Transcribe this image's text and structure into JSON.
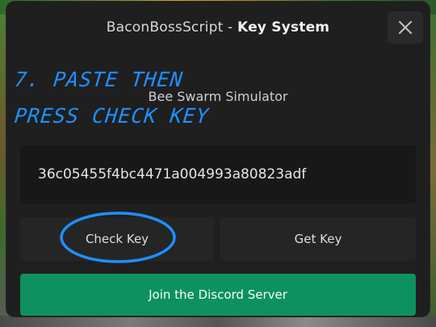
{
  "dialog": {
    "title_prefix": "BaconBossScript - ",
    "title_bold": "Key System",
    "subtitle": "Bee Swarm Simulator",
    "close_icon": "close-icon"
  },
  "key_input": {
    "value": "36c05455f4bc4471a004993a80823adf"
  },
  "buttons": {
    "check_key": "Check Key",
    "get_key": "Get Key",
    "discord": "Join the Discord Server"
  },
  "annotation": {
    "line1": "7. PASTE THEN",
    "line2": "PRESS CHECK KEY",
    "color": "#1e90ff"
  },
  "colors": {
    "dialog_bg": "#1f1f1f",
    "discord_green": "#0e9160"
  }
}
